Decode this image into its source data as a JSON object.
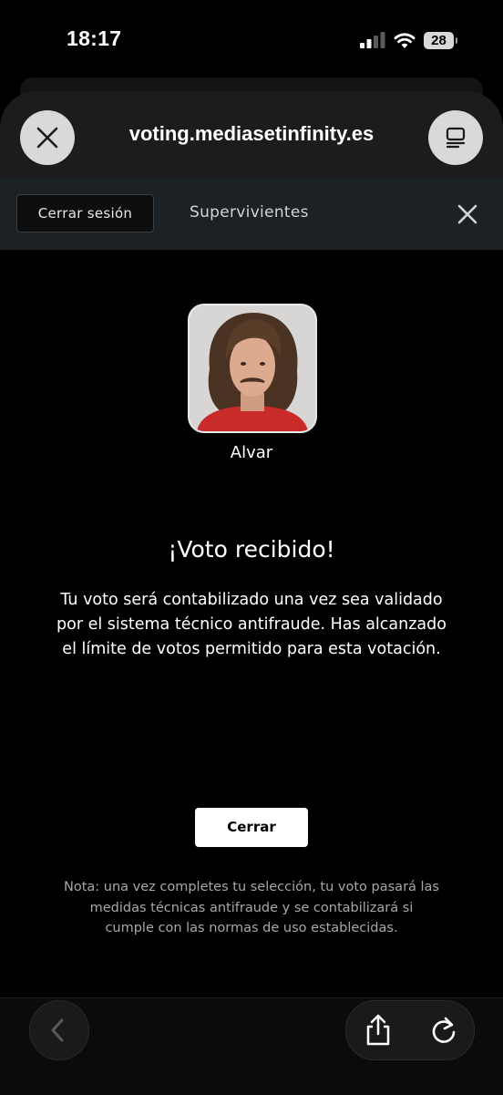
{
  "status_bar": {
    "time": "18:17",
    "battery": "28",
    "icons": [
      "cellular-signal-icon",
      "wifi-icon",
      "battery-icon"
    ]
  },
  "browser": {
    "url": "voting.mediasetinfinity.es",
    "close_icon": "close-icon",
    "tabs_icon": "tabs-icon"
  },
  "site_bar": {
    "logout_label": "Cerrar sesión",
    "title": "Supervivientes",
    "close_icon": "close-icon"
  },
  "candidate": {
    "name": "Alvar"
  },
  "confirmation": {
    "title": "¡Voto recibido!",
    "message": "Tu voto será contabilizado una vez sea validado por el sistema técnico antifraude. Has alcanzado el límite de votos permitido para esta votación.",
    "close_label": "Cerrar",
    "note": "Nota: una vez completes tu selección, tu voto pasará las medidas técnicas antifraude y se contabilizará si cumple con las normas de uso establecidas."
  },
  "toolbar": {
    "icons": [
      "back-icon",
      "share-icon",
      "reload-icon"
    ]
  },
  "colors": {
    "background": "#000000",
    "header_bg": "#1c1c1e",
    "site_bar_bg": "#1c2126",
    "button_white": "#ffffff",
    "note_text": "#a8a8a8"
  }
}
